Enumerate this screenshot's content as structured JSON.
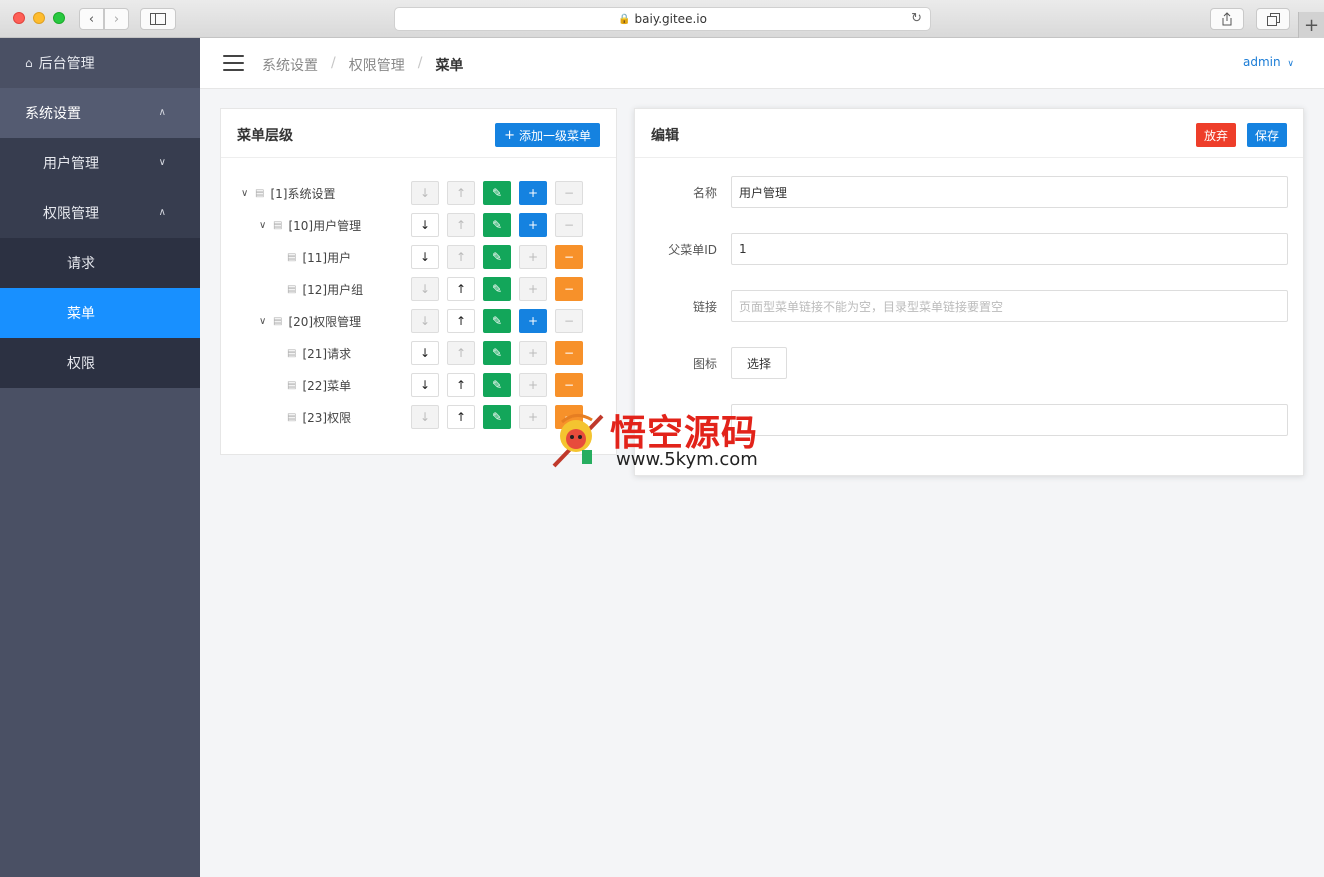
{
  "browser": {
    "url": "baiy.gitee.io"
  },
  "sidebar": {
    "home": "后台管理",
    "items": [
      {
        "label": "系统设置"
      },
      {
        "label": "用户管理"
      },
      {
        "label": "权限管理"
      },
      {
        "label": "请求"
      },
      {
        "label": "菜单"
      },
      {
        "label": "权限"
      }
    ]
  },
  "header": {
    "breadcrumb": [
      "系统设置",
      "权限管理",
      "菜单"
    ],
    "separator": "/",
    "user": "admin"
  },
  "left_panel": {
    "title": "菜单层级",
    "add_button": "添加一级菜单",
    "tree": [
      {
        "label": "[1]系统设置",
        "level": 0
      },
      {
        "label": "[10]用户管理",
        "level": 1
      },
      {
        "label": "[11]用户",
        "level": 2
      },
      {
        "label": "[12]用户组",
        "level": 2
      },
      {
        "label": "[20]权限管理",
        "level": 1
      },
      {
        "label": "[21]请求",
        "level": 2
      },
      {
        "label": "[22]菜单",
        "level": 2
      },
      {
        "label": "[23]权限",
        "level": 2
      }
    ]
  },
  "right_panel": {
    "title": "编辑",
    "discard_button": "放弃",
    "save_button": "保存",
    "fields": {
      "name_label": "名称",
      "name_value": "用户管理",
      "parent_label": "父菜单ID",
      "parent_value": "1",
      "link_label": "链接",
      "link_placeholder": "页面型菜单链接不能为空，目录型菜单链接要置空",
      "icon_label": "图标",
      "icon_button": "选择"
    }
  },
  "watermark": {
    "title": "悟空源码",
    "url": "www.5kym.com"
  }
}
